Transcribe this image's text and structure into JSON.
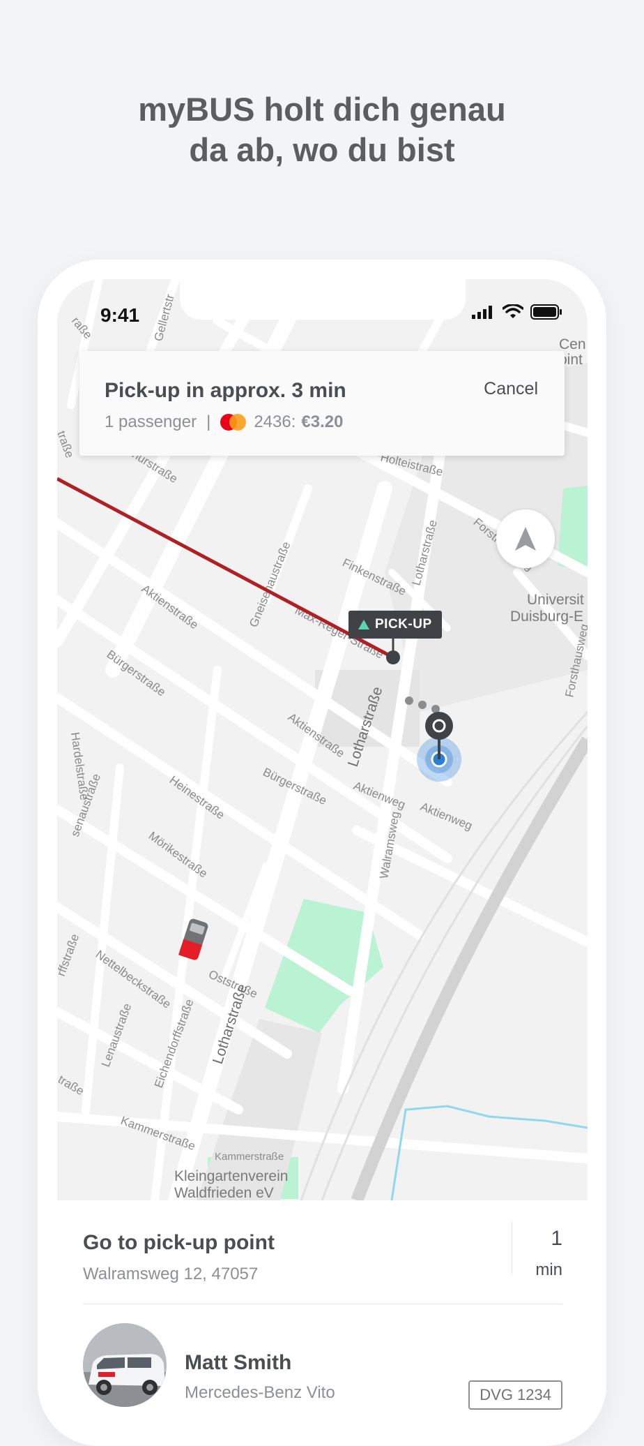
{
  "headline": {
    "line1": "myBUS holt dich genau",
    "line2": "da ab, wo du bist"
  },
  "status_bar": {
    "time": "9:41",
    "icons": [
      "signal-icon",
      "wifi-icon",
      "battery-icon"
    ]
  },
  "pickup_card": {
    "title": "Pick-up in approx. 3 min",
    "cancel_label": "Cancel",
    "passengers": "1 passenger",
    "separator": "|",
    "card_icon": "mastercard-icon",
    "card_number": "2436:",
    "price": "€3.20"
  },
  "map": {
    "pickup_tag": "PICK-UP",
    "streets": [
      "Holteistraße",
      "Lotharstraße",
      "Finkenstraße",
      "Gneisenaustraße",
      "Max-Reger-Straße",
      "Aktienstraße",
      "Bürgerstraße",
      "Heinestraße",
      "Mörikestraße",
      "Aktienweg",
      "Walramsweg",
      "Oststraße",
      "Nettelbeckstraße",
      "Eichendorffstraße",
      "Lenaustraße",
      "Kammerstraße",
      "Gellertstr",
      "Hardelstraße",
      "Forsthausweg"
    ],
    "places": [
      "Universität Duisburg-E",
      "Kleingartenverein",
      "Waldfrieden eV",
      "Cen",
      "oint"
    ],
    "colors": {
      "route": "#b01f24",
      "park": "#baf3d3",
      "water": "#8fd8ee",
      "user_location": "#2b7fd6",
      "pickup_marker": "#3f4347"
    }
  },
  "trip": {
    "title": "Go to pick-up point",
    "address": "Walramsweg 12, 47057",
    "eta_value": "1",
    "eta_unit": "min"
  },
  "driver": {
    "name": "Matt Smith",
    "vehicle": "Mercedes-Benz Vito",
    "plate": "DVG 1234"
  }
}
